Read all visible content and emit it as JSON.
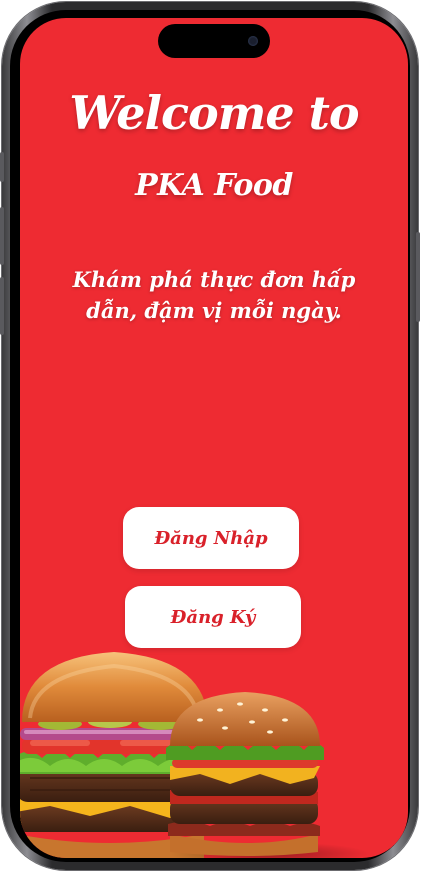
{
  "welcome": {
    "heading": "Welcome to",
    "brand": "PKA Food",
    "tagline": "Khám phá thực đơn hấp dẫn, đậm vị mỗi ngày."
  },
  "actions": {
    "login_label": "Đăng Nhập",
    "register_label": "Đăng Ký"
  },
  "colors": {
    "background": "#ee2b32",
    "button_bg": "#ffffff",
    "button_text": "#d9212a",
    "text": "#ffffff"
  },
  "images": {
    "hero": "burgers-illustration"
  }
}
